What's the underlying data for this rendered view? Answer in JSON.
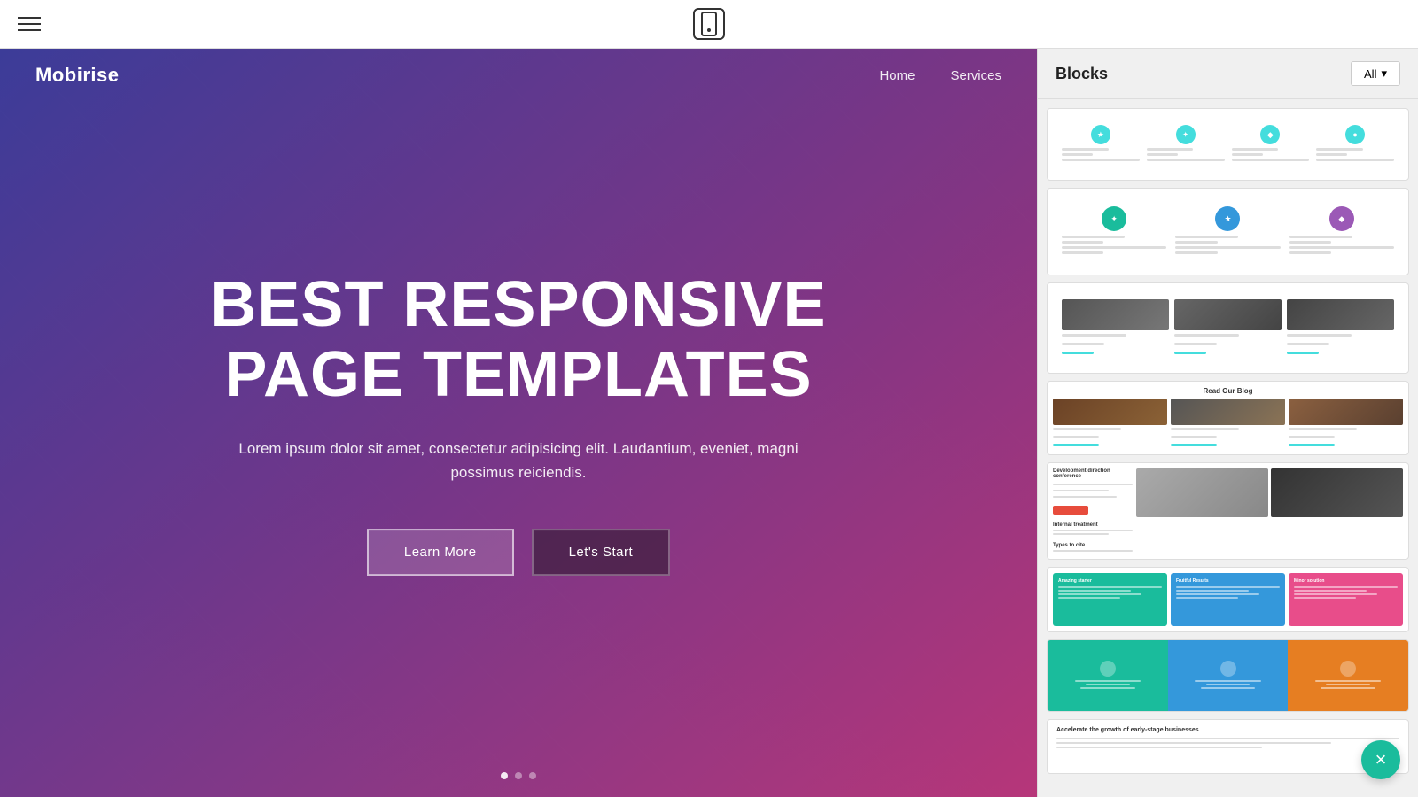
{
  "toolbar": {
    "hamburger_label": "Menu",
    "phone_icon_label": "Phone view"
  },
  "canvas": {
    "nav": {
      "brand": "Mobirise",
      "links": [
        "Home",
        "Services"
      ]
    },
    "hero": {
      "title_line1": "BEST RESPONSIVE",
      "title_line2": "PAGE TEMPLATES",
      "subtitle": "Lorem ipsum dolor sit amet, consectetur adipisicing elit. Laudantium, eveniet, magni possimus reiciendis.",
      "btn_learn_more": "Learn More",
      "btn_lets_start": "Let's Start"
    }
  },
  "right_panel": {
    "title": "Blocks",
    "filter_btn": "All",
    "filter_icon": "▾",
    "blocks": [
      {
        "id": "block-1",
        "type": "icon-cards"
      },
      {
        "id": "block-2",
        "type": "circle-features"
      },
      {
        "id": "block-3",
        "type": "photo-cards"
      },
      {
        "id": "block-4",
        "type": "blog-grid"
      },
      {
        "id": "block-5",
        "type": "news-conference"
      },
      {
        "id": "block-6",
        "type": "color-feature-cards"
      },
      {
        "id": "block-7",
        "type": "colored-blocks"
      },
      {
        "id": "block-8",
        "type": "cta-partial"
      }
    ]
  },
  "close_fab": "×"
}
